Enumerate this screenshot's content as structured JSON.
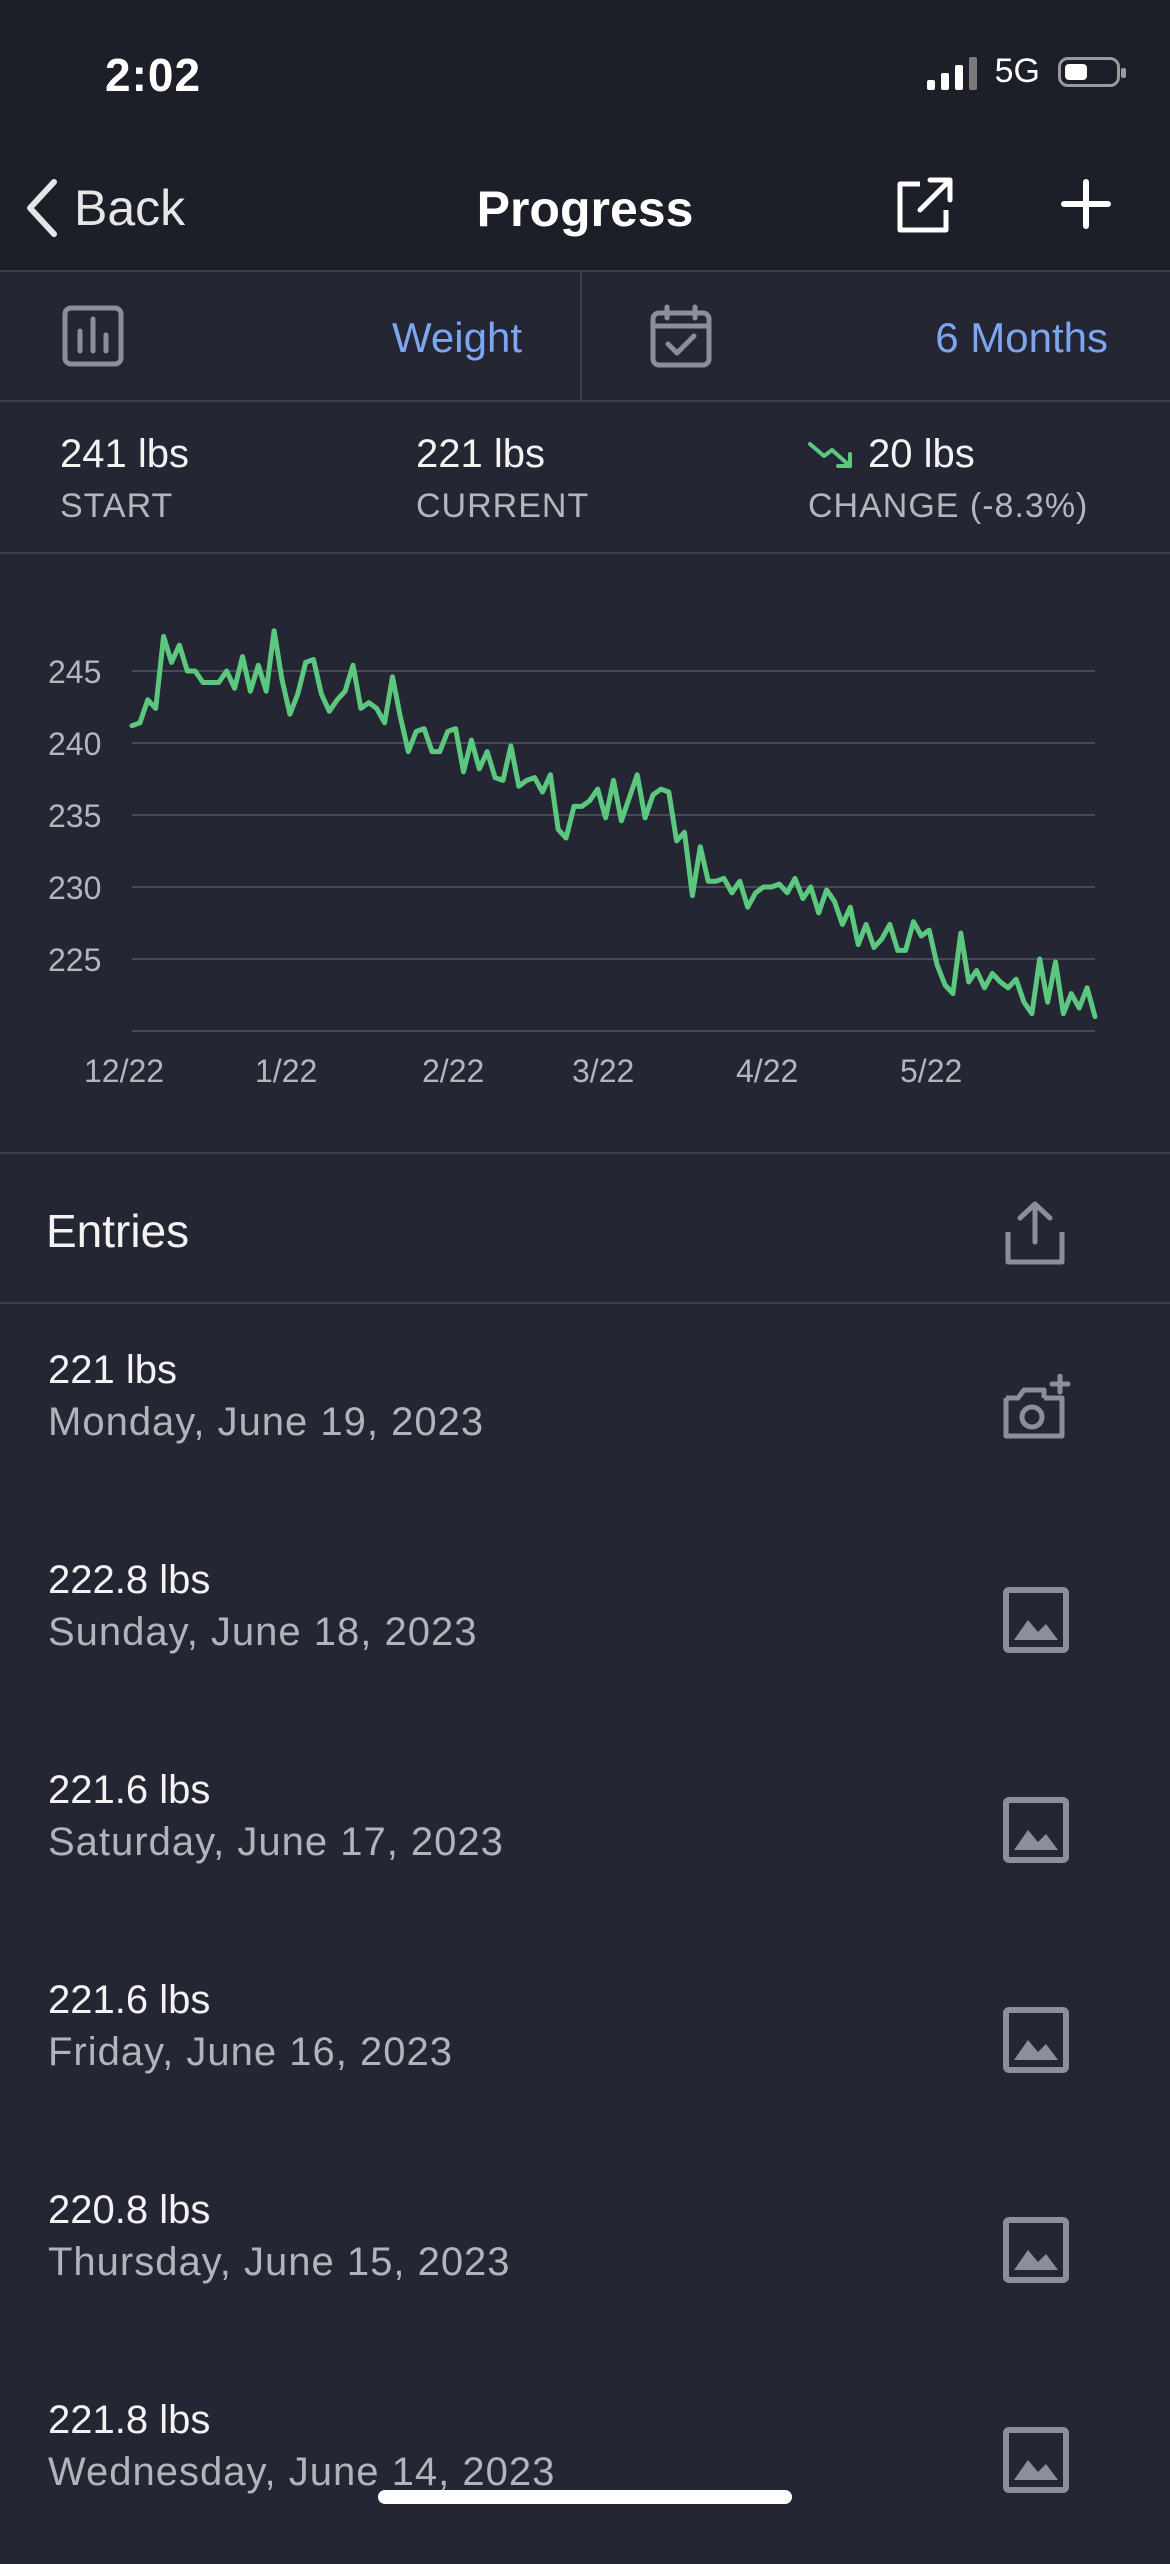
{
  "status_bar": {
    "time": "2:02",
    "network": "5G"
  },
  "nav": {
    "back_label": "Back",
    "title": "Progress"
  },
  "selectors": {
    "metric": "Weight",
    "range": "6 Months"
  },
  "stats": {
    "start": {
      "value": "241 lbs",
      "label": "START"
    },
    "current": {
      "value": "221 lbs",
      "label": "CURRENT"
    },
    "change": {
      "value": "20 lbs",
      "label": "CHANGE (-8.3%)"
    }
  },
  "colors": {
    "accent": "#7ea6f0",
    "line": "#5cc77e",
    "background": "#242733"
  },
  "chart_data": {
    "type": "line",
    "title": "",
    "xlabel": "",
    "ylabel": "",
    "ylim": [
      220,
      250
    ],
    "yticks": [
      225,
      230,
      235,
      240,
      245
    ],
    "xticks": [
      "12/22",
      "1/22",
      "2/22",
      "3/22",
      "4/22",
      "5/22"
    ],
    "grid": true,
    "series": [
      {
        "values": [
          241.2,
          241.4,
          243.0,
          242.4,
          247.4,
          245.6,
          246.8,
          245.0,
          245.0,
          244.2,
          244.2,
          244.2,
          245.0,
          243.8,
          246.0,
          243.6,
          245.4,
          243.6,
          247.8,
          244.4,
          242.0,
          243.4,
          245.6,
          245.8,
          243.4,
          242.2,
          243.0,
          243.6,
          245.4,
          242.4,
          242.8,
          242.4,
          241.4,
          244.6,
          241.8,
          239.4,
          240.8,
          241.0,
          239.4,
          239.4,
          240.8,
          241.0,
          238.0,
          240.2,
          238.2,
          239.4,
          237.6,
          237.4,
          239.8,
          237.0,
          237.4,
          237.6,
          236.6,
          237.8,
          234.0,
          233.4,
          235.6,
          235.6,
          236.0,
          236.8,
          234.8,
          237.4,
          234.6,
          236.2,
          237.8,
          234.8,
          236.4,
          236.8,
          236.6,
          233.2,
          233.8,
          229.4,
          232.8,
          230.4,
          230.4,
          230.6,
          229.6,
          230.4,
          228.6,
          229.6,
          230.0,
          230.0,
          230.2,
          229.6,
          230.6,
          229.2,
          230.0,
          228.2,
          229.8,
          229.0,
          227.4,
          228.6,
          226.0,
          227.4,
          225.8,
          226.4,
          227.4,
          225.6,
          225.6,
          227.6,
          226.6,
          227.0,
          224.6,
          223.2,
          222.6,
          226.8,
          223.4,
          224.2,
          223.0,
          224.0,
          223.4,
          223.0,
          223.6,
          222.0,
          221.2,
          225.0,
          222.0,
          224.8,
          221.2,
          222.6,
          221.6,
          223.0,
          221.0
        ]
      }
    ]
  },
  "entries": {
    "title": "Entries",
    "items": [
      {
        "weight": "221 lbs",
        "date": "Monday, June 19, 2023",
        "icon": "add-photo-icon"
      },
      {
        "weight": "222.8 lbs",
        "date": "Sunday, June 18, 2023",
        "icon": "image-icon"
      },
      {
        "weight": "221.6 lbs",
        "date": "Saturday, June 17, 2023",
        "icon": "image-icon"
      },
      {
        "weight": "221.6 lbs",
        "date": "Friday, June 16, 2023",
        "icon": "image-icon"
      },
      {
        "weight": "220.8 lbs",
        "date": "Thursday, June 15, 2023",
        "icon": "image-icon"
      },
      {
        "weight": "221.8 lbs",
        "date": "Wednesday, June 14, 2023",
        "icon": "image-icon"
      }
    ]
  }
}
